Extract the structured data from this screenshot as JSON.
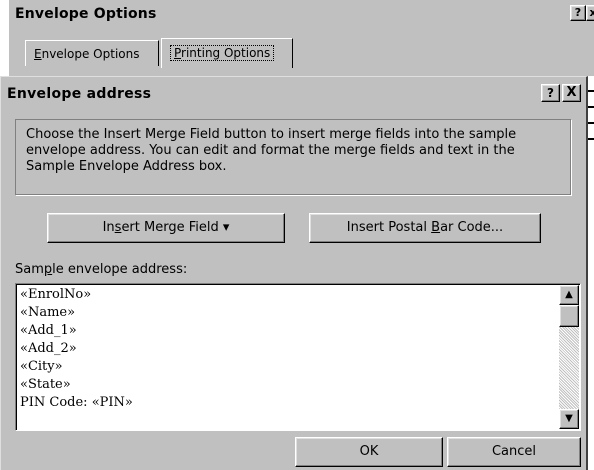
{
  "background_dialog": {
    "title": "Envelope Options",
    "help_label": "?",
    "close_label": "x",
    "tabs": [
      {
        "label_pre": "",
        "mnemonic": "E",
        "label_post": "nvelope Options"
      },
      {
        "label_pre": "",
        "mnemonic": "P",
        "label_post": "rinting Options"
      }
    ]
  },
  "dialog": {
    "title": "Envelope address",
    "help_label": "?",
    "close_label": "X",
    "instructions": "Choose the Insert Merge Field button to insert merge fields into the sample envelope address.  You can edit and format the merge fields and text in the Sample Envelope Address box.",
    "insert_merge_field": {
      "label_pre": "In",
      "mnemonic": "s",
      "label_post": "ert Merge Field",
      "arrow": "▾"
    },
    "insert_postal_bar_code": {
      "label_pre": "Insert Postal ",
      "mnemonic": "B",
      "label_post": "ar Code..."
    },
    "sample_label": {
      "label_pre": "Sam",
      "mnemonic": "p",
      "label_post": "le envelope address:"
    },
    "address_lines": [
      "«EnrolNo»",
      "«Name»",
      "«Add_1»",
      "«Add_2»",
      "«City»",
      "«State»",
      "PIN Code: «PIN»"
    ],
    "scroll_up_icon": "▲",
    "scroll_down_icon": "▼",
    "ok_label": "OK",
    "cancel_label": "Cancel"
  },
  "colors": {
    "face": "#c0c0c0",
    "shadow": "#808080",
    "highlight": "#ffffff"
  }
}
